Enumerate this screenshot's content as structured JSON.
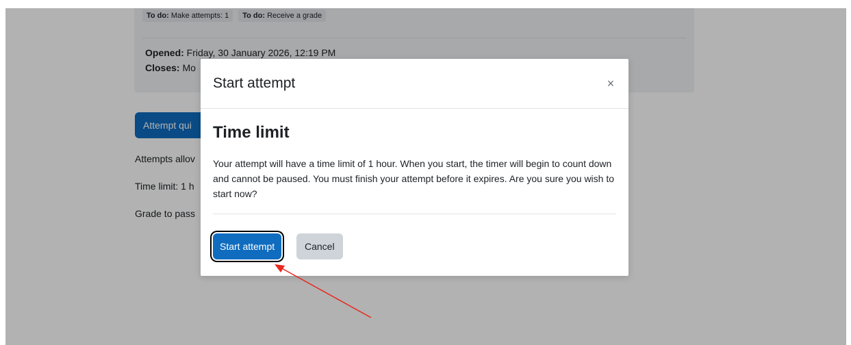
{
  "page": {
    "todo_items": [
      {
        "prefix": "To do:",
        "text": "Make attempts: 1"
      },
      {
        "prefix": "To do:",
        "text": "Receive a grade"
      }
    ],
    "opened_label": "Opened:",
    "opened_value": "Friday, 30 January 2026, 12:19 PM",
    "closes_label": "Closes:",
    "closes_value": "Mo",
    "attempt_quiz_button": "Attempt qui",
    "attempts_allowed": "Attempts allov",
    "time_limit": "Time limit: 1 h",
    "grade_to_pass": "Grade to pass"
  },
  "modal": {
    "title": "Start attempt",
    "close_symbol": "×",
    "body_title": "Time limit",
    "body_text": "Your attempt will have a time limit of 1 hour. When you start, the timer will begin to count down and cannot be paused. You must finish your attempt before it expires. Are you sure you wish to start now?",
    "start_button": "Start attempt",
    "cancel_button": "Cancel"
  },
  "colors": {
    "primary": "#0f6cbf",
    "secondary": "#ced4da",
    "annotation_arrow": "#e8281e"
  },
  "icons": {
    "close": "close-icon",
    "annotation": "red-arrow-icon"
  }
}
